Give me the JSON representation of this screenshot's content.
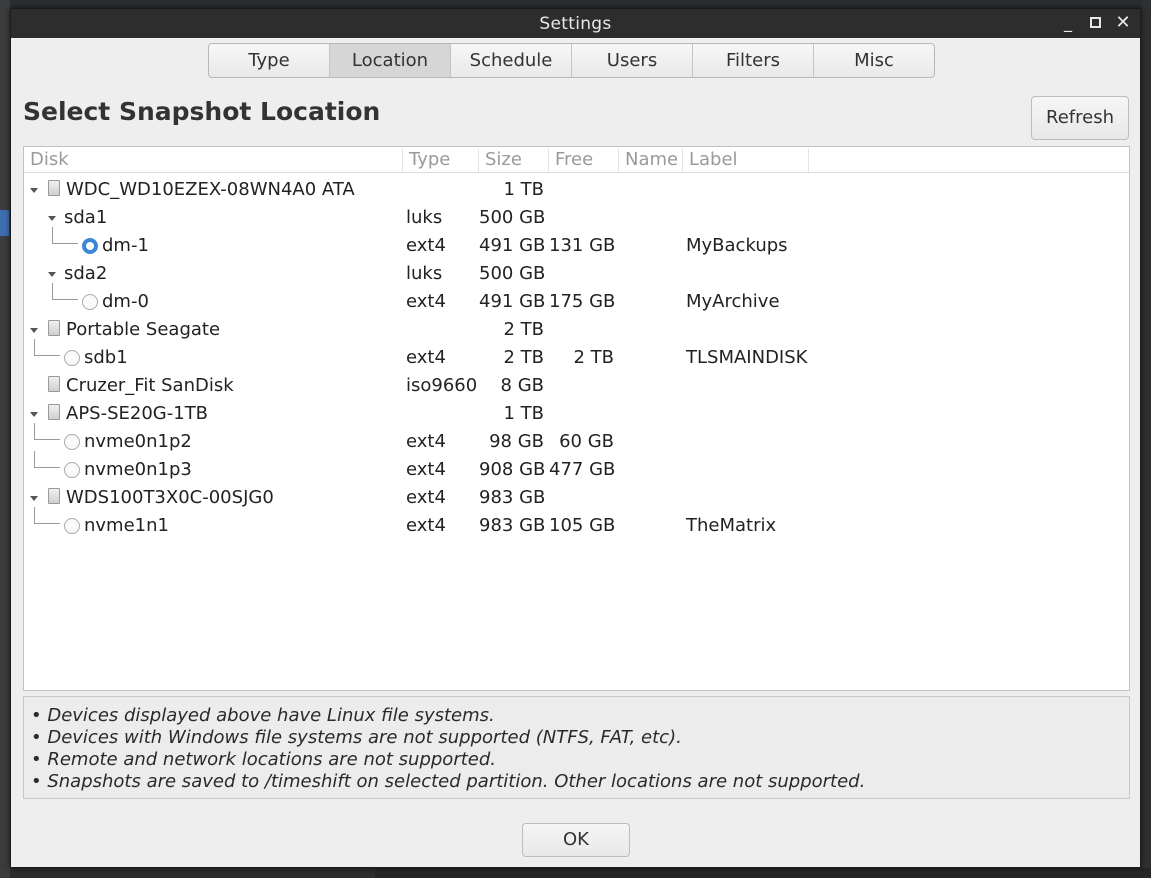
{
  "window": {
    "title": "Settings",
    "controls": {
      "minimize": "_",
      "close": "✕"
    }
  },
  "tabs": [
    "Type",
    "Location",
    "Schedule",
    "Users",
    "Filters",
    "Misc"
  ],
  "active_tab": "Location",
  "heading": "Select Snapshot Location",
  "refresh_label": "Refresh",
  "columns": {
    "disk": "Disk",
    "type": "Type",
    "size": "Size",
    "free": "Free",
    "name": "Name",
    "label": "Label"
  },
  "devices": [
    {
      "kind": "disk",
      "name": "WDC_WD10EZEX-08WN4A0 ATA",
      "type": "",
      "size": "1 TB",
      "free": "",
      "label": "",
      "expanded": true
    },
    {
      "kind": "part",
      "name": "sda1",
      "type": "luks",
      "size": "500 GB",
      "free": "",
      "label": "",
      "expanded": true
    },
    {
      "kind": "vol",
      "name": "dm-1",
      "type": "ext4",
      "size": "491 GB",
      "free": "131 GB",
      "label": "MyBackups",
      "selected": true
    },
    {
      "kind": "part",
      "name": "sda2",
      "type": "luks",
      "size": "500 GB",
      "free": "",
      "label": "",
      "expanded": true
    },
    {
      "kind": "vol",
      "name": "dm-0",
      "type": "ext4",
      "size": "491 GB",
      "free": "175 GB",
      "label": "MyArchive",
      "selected": false
    },
    {
      "kind": "disk",
      "name": "Portable Seagate",
      "type": "",
      "size": "2 TB",
      "free": "",
      "label": "",
      "expanded": true
    },
    {
      "kind": "diskpart",
      "name": "sdb1",
      "type": "ext4",
      "size": "2 TB",
      "free": "2 TB",
      "label": "TLSMAINDISK",
      "selected": false
    },
    {
      "kind": "disk-leaf",
      "name": "Cruzer_Fit SanDisk",
      "type": "iso9660",
      "size": "8 GB",
      "free": "",
      "label": ""
    },
    {
      "kind": "disk",
      "name": "APS-SE20G-1TB",
      "type": "",
      "size": "1 TB",
      "free": "",
      "label": "",
      "expanded": true
    },
    {
      "kind": "diskpart",
      "name": "nvme0n1p2",
      "type": "ext4",
      "size": "98 GB",
      "free": "60 GB",
      "label": "",
      "selected": false
    },
    {
      "kind": "diskpart",
      "name": "nvme0n1p3",
      "type": "ext4",
      "size": "908 GB",
      "free": "477 GB",
      "label": "",
      "selected": false
    },
    {
      "kind": "disk",
      "name": "WDS100T3X0C-00SJG0",
      "type": "ext4",
      "size": "983 GB",
      "free": "",
      "label": "",
      "expanded": true
    },
    {
      "kind": "diskpart",
      "name": "nvme1n1",
      "type": "ext4",
      "size": "983 GB",
      "free": "105 GB",
      "label": "TheMatrix",
      "selected": false
    }
  ],
  "notes": [
    "• Devices displayed above have Linux file systems.",
    "• Devices with Windows file systems are not supported (NTFS, FAT, etc).",
    "• Remote and network locations are not supported.",
    "• Snapshots are saved to /timeshift on selected partition. Other locations are not supported."
  ],
  "ok_label": "OK"
}
